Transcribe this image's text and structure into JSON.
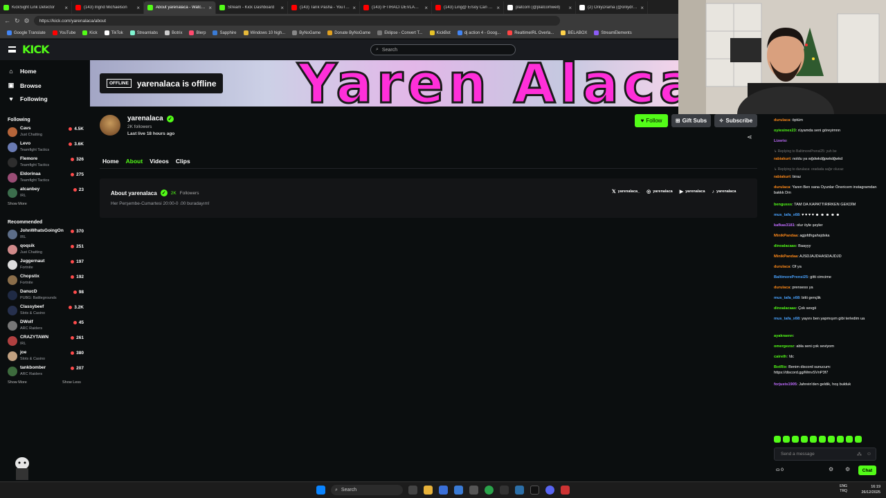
{
  "browser": {
    "tabs": [
      {
        "title": "KickSight Link Detector",
        "color": "#53fc18"
      },
      {
        "title": "(143) Ingrid Michaelson",
        "color": "#ff0000"
      },
      {
        "title": "About yarenalaca - Watch Li",
        "color": "#53fc18",
        "active": true
      },
      {
        "title": "Stream - Kick Dashboard",
        "color": "#53fc18"
      },
      {
        "title": "(143) Tarık Pasha - YouTube",
        "color": "#ff0000"
      },
      {
        "title": "(143) İFTİRACI DEVLADINA",
        "color": "#ff0000"
      },
      {
        "title": "(143) Ling@ Ersoy Can Özkan",
        "color": "#ff0000"
      },
      {
        "title": "platcom (@platcomwell)",
        "color": "#ffffff"
      },
      {
        "title": "(2) OnlyDrama (@onlydrama)",
        "color": "#ffffff"
      }
    ],
    "url": "https://kick.com/yarenalaca/about",
    "bookmarks": [
      {
        "label": "Google Translate",
        "color": "#4285f4"
      },
      {
        "label": "YouTube",
        "color": "#ff0000"
      },
      {
        "label": "Kick",
        "color": "#53fc18"
      },
      {
        "label": "TikTok",
        "color": "#ffffff"
      },
      {
        "label": "Streamlabs",
        "color": "#80f5d2"
      },
      {
        "label": "Botrix",
        "color": "#cccccc"
      },
      {
        "label": "Blerp",
        "color": "#ff4a6e"
      },
      {
        "label": "Sapphire",
        "color": "#3a7bd5"
      },
      {
        "label": "Windows 10 high...",
        "color": "#e6b93a"
      },
      {
        "label": "ByNoGame",
        "color": "#888888"
      },
      {
        "label": "Donate ByNoGame",
        "color": "#e0a020"
      },
      {
        "label": "Eklipse - Convert T...",
        "color": "#777777"
      },
      {
        "label": "KickBot",
        "color": "#e6c229"
      },
      {
        "label": "dj action 4 - Goog...",
        "color": "#4285f4"
      },
      {
        "label": "RealtimeIRL Overla...",
        "color": "#ff4444"
      },
      {
        "label": "BELABOX",
        "color": "#ffd24a"
      },
      {
        "label": "StreamElements",
        "color": "#8b5cf6"
      }
    ]
  },
  "header": {
    "logo": "KICK",
    "search_placeholder": "Search"
  },
  "sidebar": {
    "nav": [
      {
        "label": "Home",
        "icon": "⌂"
      },
      {
        "label": "Browse",
        "icon": "▣"
      },
      {
        "label": "Following",
        "icon": "♥"
      }
    ],
    "following_title": "Following",
    "following": [
      {
        "name": "Cavs",
        "category": "Just Chatting",
        "viewers": "4.5K",
        "color": "#b5653a"
      },
      {
        "name": "Levo",
        "category": "Teamfight Tactics",
        "viewers": "3.6K",
        "color": "#6a7bb3"
      },
      {
        "name": "Flemore",
        "category": "Teamfight Tactics",
        "viewers": "326",
        "color": "#2d2d2d"
      },
      {
        "name": "Eldorinaa",
        "category": "Teamfight Tactics",
        "viewers": "275",
        "color": "#9a4d75"
      },
      {
        "name": "atcanbey",
        "category": "IRL",
        "viewers": "23",
        "color": "#3b6d4c"
      }
    ],
    "following_more": "Show More",
    "recommended_title": "Recommended",
    "recommended": [
      {
        "name": "JohnWhatsGoingOn",
        "category": "IRL",
        "viewers": "370",
        "color": "#5c6d88"
      },
      {
        "name": "qoqsik",
        "category": "Just Chatting",
        "viewers": "251",
        "color": "#d08a8a"
      },
      {
        "name": "Juggernaut",
        "category": "Fortnite",
        "viewers": "197",
        "color": "#dddddd"
      },
      {
        "name": "Chopstix",
        "category": "Fortnite",
        "viewers": "192",
        "color": "#8b6e4a"
      },
      {
        "name": "DanucD",
        "category": "PUBG: Battlegrounds",
        "viewers": "98",
        "color": "#1f2a44"
      },
      {
        "name": "Classybeef",
        "category": "Slots & Casino",
        "viewers": "3.2K",
        "color": "#26304d"
      },
      {
        "name": "DWolf",
        "category": "ARC Raiders",
        "viewers": "45",
        "color": "#777777"
      },
      {
        "name": "CRAZYTAWN",
        "category": "IRL",
        "viewers": "261",
        "color": "#b04040"
      },
      {
        "name": "joe",
        "category": "Slots & Casino",
        "viewers": "380",
        "color": "#c0a080"
      },
      {
        "name": "tankbomber",
        "category": "ARC Raiders",
        "viewers": "207",
        "color": "#3d6b3d"
      }
    ],
    "recommended_more": "Show More",
    "recommended_less": "Show Less"
  },
  "banner": {
    "art_text": "Yaren Alaca",
    "offline_badge": "OFFLINE",
    "offline_text": "yarenalaca is offline"
  },
  "profile": {
    "name": "yarenalaca",
    "followers": "2K followers",
    "last_live": "Last live 18 hours ago",
    "follow_label": "Follow",
    "gift_label": "Gift Subs",
    "subscribe_label": "Subscribe",
    "tabs": [
      "Home",
      "About",
      "Videos",
      "Clips"
    ],
    "active_tab": "About"
  },
  "about": {
    "title": "About yarenalaca",
    "followers_count": "2K",
    "followers_label": "Followers",
    "description": "Her Perşembe-Cumartesi 20:00-0 .00 buradayım!",
    "socials": [
      {
        "icon": "x-icon",
        "glyph": "𝕏",
        "handle": "yarenalaca_"
      },
      {
        "icon": "instagram-icon",
        "glyph": "◎",
        "handle": "yarenalaca"
      },
      {
        "icon": "youtube-icon",
        "glyph": "▶",
        "handle": "yarenalaca"
      },
      {
        "icon": "tiktok-icon",
        "glyph": "♪",
        "handle": "yarenalaca"
      }
    ]
  },
  "chat": {
    "messages": [
      {
        "user": "durulaca",
        "color": "#ff8a1a",
        "text": "öptüm"
      },
      {
        "user": "oyiesinex23",
        "color": "#53fc18",
        "text": "rüyamda seni göreyimnn"
      },
      {
        "user": "Lizerio",
        "color": "#c06cff",
        "text": ""
      },
      {
        "reply": "↳ Replying to BaltimorePrensi25: yuh be"
      },
      {
        "user": "rabiakurt",
        "color": "#ff8a1a",
        "text": "noldu ya wğdwkdğpwkdğwkd"
      },
      {
        "reply": "↳ Replying to durulaca: oradada sağır olucaz"
      },
      {
        "user": "rabiakurt",
        "color": "#ff8a1a",
        "text": "biraz"
      },
      {
        "user": "durulaca",
        "color": "#ff8a1a",
        "text": "Yaren Ben sana Oyunlar Önericem instagramdan bakkk Dm"
      },
      {
        "user": "bengusss",
        "color": "#53fc18",
        "text": "TAM DA KAPATTIRIRKEN GEKDİM"
      },
      {
        "user": "mus_tafa_x68",
        "color": "#4aa3ff",
        "text": "♥ ♥ ♥ ♥ ☻ ☻ ☻ ☻ ☻"
      },
      {
        "user": "kafkas3181",
        "color": "#c06cff",
        "text": "olur öyle şeyler"
      },
      {
        "user": "MinikPandaa",
        "color": "#ff8a1a",
        "text": "agjsfdhgahsjdska"
      },
      {
        "user": "dinoalacaas",
        "color": "#53fc18",
        "text": "Baayyy"
      },
      {
        "user": "MinikPandaa",
        "color": "#ff8a1a",
        "text": "AJSDJAJDHASDAJDJD"
      },
      {
        "user": "durulaca",
        "color": "#ff8a1a",
        "text": "Of ya"
      },
      {
        "user": "BaltimorePrensi25",
        "color": "#4aa3ff",
        "text": "gitti cimcime"
      },
      {
        "user": "durulaca",
        "color": "#ff8a1a",
        "text": "prensess ya"
      },
      {
        "user": "mus_tafa_x68",
        "color": "#4aa3ff",
        "text": "bitti gençlik"
      },
      {
        "user": "dinoalacaas",
        "color": "#53fc18",
        "text": "Çok sevgii"
      },
      {
        "user": "mus_tafa_x68",
        "color": "#4aa3ff",
        "text": "yayını ben yapmışım gibi terledim ua"
      },
      {
        "user": "ayakraenn",
        "color": "#53fc18",
        "text": ""
      },
      {
        "user": "omergezoz",
        "color": "#53fc18",
        "text": "abla seni çok seviyom"
      },
      {
        "user": "caireth",
        "color": "#53fc18",
        "text": "!dc"
      },
      {
        "user": "BotRix",
        "color": "#53fc18",
        "text": "Benim discord sunucum: https://discord.gg/MmvSVnP3f7"
      },
      {
        "user": "forjusts1905",
        "color": "#c06cff",
        "text": "Jahrein'den geldik, hoş bulduk"
      }
    ],
    "input_placeholder": "Send a message",
    "points": "0",
    "send_label": "Chat"
  },
  "taskbar": {
    "search_placeholder": "Search",
    "lang_top": "ENG",
    "lang_bottom": "TRQ",
    "time": "16:19",
    "date": "26/12/2025"
  }
}
